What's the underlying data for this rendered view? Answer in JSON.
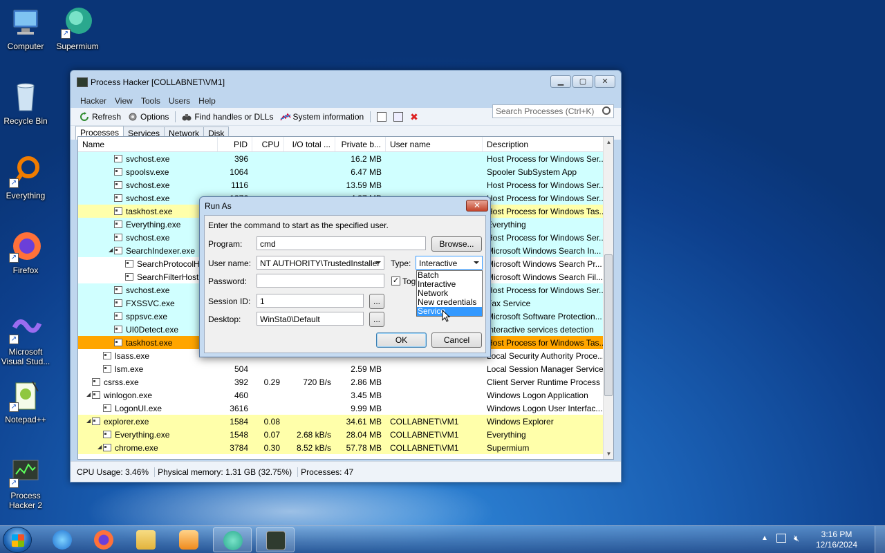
{
  "desktop": {
    "icons": [
      {
        "label": "Computer"
      },
      {
        "label": "Supermium"
      },
      {
        "label": "Recycle Bin"
      },
      {
        "label": "Everything"
      },
      {
        "label": "Firefox"
      },
      {
        "label": "Microsoft Visual Stud..."
      },
      {
        "label": "Notepad++"
      },
      {
        "label": "Process Hacker 2"
      }
    ]
  },
  "window": {
    "title": "Process Hacker [COLLABNET\\VM1]",
    "menu": [
      "Hacker",
      "View",
      "Tools",
      "Users",
      "Help"
    ],
    "toolbar": {
      "refresh": "Refresh",
      "options": "Options",
      "find_handles": "Find handles or DLLs",
      "system_info": "System information",
      "search_placeholder": "Search Processes (Ctrl+K)"
    },
    "tabs": [
      "Processes",
      "Services",
      "Network",
      "Disk"
    ],
    "columns": [
      "Name",
      "PID",
      "CPU",
      "I/O total ...",
      "Private b...",
      "User name",
      "Description"
    ],
    "rows": [
      {
        "name": "svchost.exe",
        "pid": "396",
        "cpu": "",
        "io": "",
        "priv": "16.2 MB",
        "user": "",
        "desc": "Host Process for Windows Ser..."
      },
      {
        "name": "spoolsv.exe",
        "pid": "1064",
        "cpu": "",
        "io": "",
        "priv": "6.47 MB",
        "user": "",
        "desc": "Spooler SubSystem App"
      },
      {
        "name": "svchost.exe",
        "pid": "1116",
        "cpu": "",
        "io": "",
        "priv": "13.59 MB",
        "user": "",
        "desc": "Host Process for Windows Ser..."
      },
      {
        "name": "svchost.exe",
        "pid": "1376",
        "cpu": "",
        "io": "",
        "priv": "4.37 MB",
        "user": "",
        "desc": "Host Process for Windows Ser..."
      },
      {
        "name": "taskhost.exe",
        "pid": "",
        "cpu": "",
        "io": "",
        "priv": "",
        "user": "",
        "desc": "Host Process for Windows Tas..."
      },
      {
        "name": "Everything.exe",
        "pid": "",
        "cpu": "",
        "io": "",
        "priv": "",
        "user": "",
        "desc": "Everything"
      },
      {
        "name": "svchost.exe",
        "pid": "",
        "cpu": "",
        "io": "",
        "priv": "",
        "user": "",
        "desc": "Host Process for Windows Ser..."
      },
      {
        "name": "SearchIndexer.exe",
        "pid": "",
        "cpu": "",
        "io": "",
        "priv": "",
        "user": "",
        "desc": "Microsoft Windows Search In..."
      },
      {
        "name": "SearchProtocolH",
        "pid": "",
        "cpu": "",
        "io": "",
        "priv": "",
        "user": "",
        "desc": "Microsoft Windows Search Pr..."
      },
      {
        "name": "SearchFilterHost",
        "pid": "",
        "cpu": "",
        "io": "",
        "priv": "",
        "user": "",
        "desc": "Microsoft Windows Search Fil..."
      },
      {
        "name": "svchost.exe",
        "pid": "",
        "cpu": "",
        "io": "",
        "priv": "",
        "user": "",
        "desc": "Host Process for Windows Ser..."
      },
      {
        "name": "FXSSVC.exe",
        "pid": "",
        "cpu": "",
        "io": "",
        "priv": "",
        "user": "",
        "desc": "Fax Service"
      },
      {
        "name": "sppsvc.exe",
        "pid": "",
        "cpu": "",
        "io": "",
        "priv": "",
        "user": "",
        "desc": "Microsoft Software Protection..."
      },
      {
        "name": "UI0Detect.exe",
        "pid": "",
        "cpu": "",
        "io": "",
        "priv": "",
        "user": "",
        "desc": "Interactive services detection"
      },
      {
        "name": "taskhost.exe",
        "pid": "",
        "cpu": "",
        "io": "",
        "priv": "",
        "user": "",
        "desc": "Host Process for Windows Tas..."
      },
      {
        "name": "lsass.exe",
        "pid": "",
        "cpu": "",
        "io": "",
        "priv": "",
        "user": "",
        "desc": "Local Security Authority Proce..."
      },
      {
        "name": "lsm.exe",
        "pid": "504",
        "cpu": "",
        "io": "",
        "priv": "2.59 MB",
        "user": "",
        "desc": "Local Session Manager Service"
      },
      {
        "name": "csrss.exe",
        "pid": "392",
        "cpu": "0.29",
        "io": "720 B/s",
        "priv": "2.86 MB",
        "user": "",
        "desc": "Client Server Runtime Process"
      },
      {
        "name": "winlogon.exe",
        "pid": "460",
        "cpu": "",
        "io": "",
        "priv": "3.45 MB",
        "user": "",
        "desc": "Windows Logon Application"
      },
      {
        "name": "LogonUI.exe",
        "pid": "3616",
        "cpu": "",
        "io": "",
        "priv": "9.99 MB",
        "user": "",
        "desc": "Windows Logon User Interfac..."
      },
      {
        "name": "explorer.exe",
        "pid": "1584",
        "cpu": "0.08",
        "io": "",
        "priv": "34.61 MB",
        "user": "COLLABNET\\VM1",
        "desc": "Windows Explorer"
      },
      {
        "name": "Everything.exe",
        "pid": "1548",
        "cpu": "0.07",
        "io": "2.68 kB/s",
        "priv": "28.04 MB",
        "user": "COLLABNET\\VM1",
        "desc": "Everything"
      },
      {
        "name": "chrome.exe",
        "pid": "3784",
        "cpu": "0.30",
        "io": "8.52 kB/s",
        "priv": "57.78 MB",
        "user": "COLLABNET\\VM1",
        "desc": "Supermium"
      }
    ],
    "status": {
      "cpu": "CPU Usage: 3.46%",
      "memory": "Physical memory: 1.31 GB (32.75%)",
      "processes": "Processes: 47"
    }
  },
  "dialog": {
    "title": "Run As",
    "instruction": "Enter the command to start as the specified user.",
    "program_label": "Program:",
    "program_value": "cmd",
    "browse": "Browse...",
    "username_label": "User name:",
    "username_value": "NT AUTHORITY\\TrustedInstaller",
    "type_label": "Type:",
    "type_value": "Interactive",
    "type_options": [
      "Batch",
      "Interactive",
      "Network",
      "New credentials",
      "Service"
    ],
    "type_highlighted": "Service",
    "password_label": "Password:",
    "toggle_label": "Togg",
    "session_label": "Session ID:",
    "session_value": "1",
    "desktop_label": "Desktop:",
    "desktop_value": "WinSta0\\Default",
    "ellipsis": "...",
    "ok": "OK",
    "cancel": "Cancel"
  },
  "taskbar": {
    "time": "3:16 PM",
    "date": "12/16/2024"
  },
  "colors": {
    "service_row": "#d0ffff",
    "own_process_row": "#ffffaa",
    "selected_row": "#ffa500",
    "dropdown_highlight": "#3399ff"
  }
}
